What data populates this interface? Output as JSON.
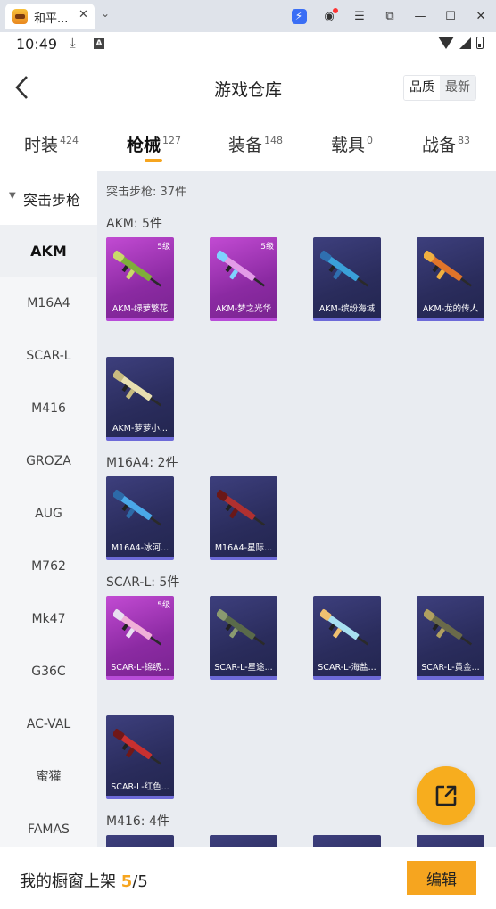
{
  "window": {
    "tab_title": "和平...",
    "tab_close": "✕",
    "chevron": "⌄",
    "icons": [
      "bolt-icon",
      "account-icon",
      "menu-icon",
      "restore-icon",
      "minimize-icon",
      "maximize-icon",
      "close-icon"
    ]
  },
  "status": {
    "time": "10:49"
  },
  "header": {
    "title": "游戏仓库",
    "sort_quality": "品质",
    "sort_newest": "最新"
  },
  "categories": [
    {
      "label": "时装",
      "count": "424"
    },
    {
      "label": "枪械",
      "count": "127"
    },
    {
      "label": "装备",
      "count": "148"
    },
    {
      "label": "载具",
      "count": "0"
    },
    {
      "label": "战备",
      "count": "83"
    }
  ],
  "sidebar": {
    "section": "突击步枪",
    "items": [
      "AKM",
      "M16A4",
      "SCAR-L",
      "M416",
      "GROZA",
      "AUG",
      "M762",
      "Mk47",
      "G36C",
      "AC-VAL",
      "蜜獾",
      "FAMAS"
    ]
  },
  "content": {
    "crumb": "突击步枪: 37件",
    "groups": [
      {
        "title": "AKM: 5件",
        "cards": [
          {
            "name": "AKM-绿萝繁花",
            "level": "5级",
            "rarity": "purple"
          },
          {
            "name": "AKM-梦之光华",
            "level": "5级",
            "rarity": "purple"
          },
          {
            "name": "AKM-缤纷海域",
            "level": "",
            "rarity": "blue"
          },
          {
            "name": "AKM-龙的传人",
            "level": "",
            "rarity": "blue"
          },
          {
            "name": "AKM-萝萝小...",
            "level": "",
            "rarity": "blue"
          }
        ]
      },
      {
        "title": "M16A4: 2件",
        "cards": [
          {
            "name": "M16A4-冰河...",
            "level": "",
            "rarity": "blue"
          },
          {
            "name": "M16A4-星际...",
            "level": "",
            "rarity": "blue"
          }
        ]
      },
      {
        "title": "SCAR-L: 5件",
        "cards": [
          {
            "name": "SCAR-L-锦绣...",
            "level": "5级",
            "rarity": "purple"
          },
          {
            "name": "SCAR-L-星途...",
            "level": "",
            "rarity": "blue"
          },
          {
            "name": "SCAR-L-海盐...",
            "level": "",
            "rarity": "blue"
          },
          {
            "name": "SCAR-L-黄金...",
            "level": "",
            "rarity": "blue"
          },
          {
            "name": "SCAR-L-红色...",
            "level": "",
            "rarity": "blue"
          }
        ]
      },
      {
        "title": "M416: 4件",
        "cards": []
      }
    ]
  },
  "bottom": {
    "showcase_label": "我的橱窗上架",
    "showcase_count": "5",
    "showcase_total": "/5",
    "edit": "编辑"
  },
  "colors": {
    "accent": "#f6a51f",
    "purple_card": "#8b2aa2",
    "blue_card": "#2a2c5c"
  }
}
